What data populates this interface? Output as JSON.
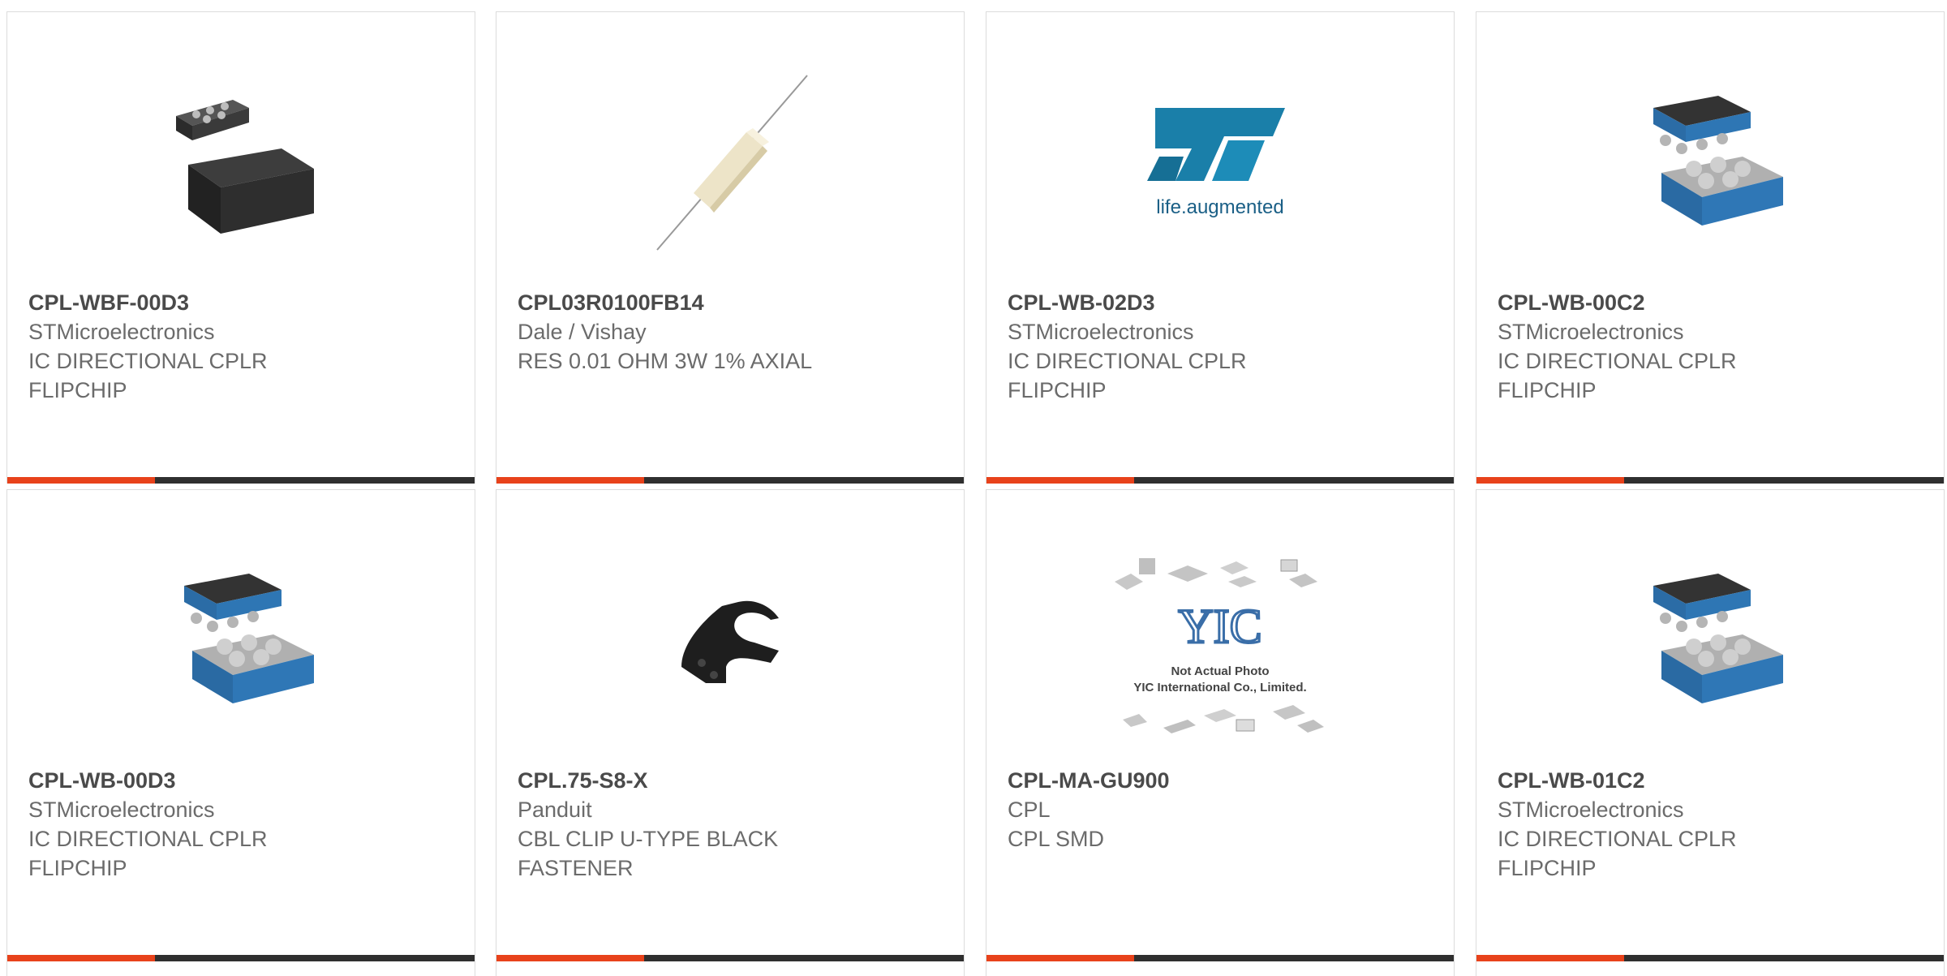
{
  "products": [
    {
      "part": "CPL-WBF-00D3",
      "manufacturer": "STMicroelectronics",
      "description": "IC DIRECTIONAL CPLR FLIPCHIP",
      "image": "flipchip-dual-icon"
    },
    {
      "part": "CPL03R0100FB14",
      "manufacturer": "Dale / Vishay",
      "description": "RES 0.01 OHM 3W 1% AXIAL",
      "image": "axial-resistor-icon"
    },
    {
      "part": "CPL-WB-02D3",
      "manufacturer": "STMicroelectronics",
      "description": "IC DIRECTIONAL CPLR FLIPCHIP",
      "image": "st-logo",
      "logo_tagline": "life.augmented"
    },
    {
      "part": "CPL-WB-00C2",
      "manufacturer": "STMicroelectronics",
      "description": "IC DIRECTIONAL CPLR FLIPCHIP",
      "image": "flipchip-bga-icon"
    },
    {
      "part": "CPL-WB-00D3",
      "manufacturer": "STMicroelectronics",
      "description": "IC DIRECTIONAL CPLR FLIPCHIP",
      "image": "flipchip-bga-icon"
    },
    {
      "part": "CPL.75-S8-X",
      "manufacturer": "Panduit",
      "description": "CBL CLIP U-TYPE BLACK FASTENER",
      "image": "cable-clip-icon"
    },
    {
      "part": "CPL-MA-GU900",
      "manufacturer": "CPL",
      "description": "CPL SMD",
      "image": "yic-placeholder",
      "placeholder_line1": "Not Actual Photo",
      "placeholder_line2": "YIC International Co., Limited."
    },
    {
      "part": "CPL-WB-01C2",
      "manufacturer": "STMicroelectronics",
      "description": "IC DIRECTIONAL CPLR FLIPCHIP",
      "image": "flipchip-bga-icon"
    }
  ],
  "colors": {
    "accent": "#e8421b",
    "bar": "#2f2f2f",
    "st_blue": "#1a7fa9"
  }
}
